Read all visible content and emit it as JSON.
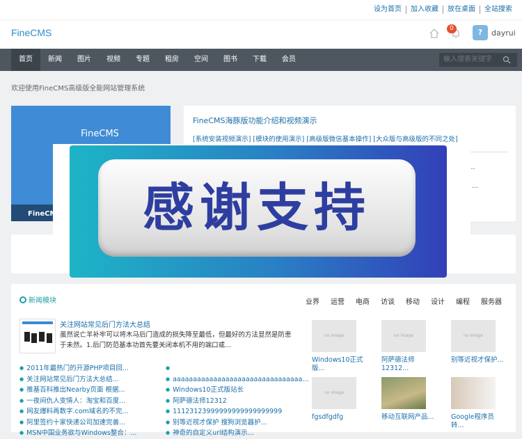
{
  "topbar": {
    "links": [
      "设为首页",
      "加入收藏",
      "放在桌面",
      "全站搜索"
    ]
  },
  "header": {
    "logo": "FineCMS",
    "notification_count": "0",
    "avatar_glyph": "?",
    "username": "dayrui"
  },
  "nav": {
    "items": [
      "首页",
      "新闻",
      "图片",
      "视频",
      "专题",
      "租房",
      "空间",
      "图书",
      "下载",
      "会员"
    ],
    "search_placeholder": "输入搜索关键字"
  },
  "welcome": "欢迎使用FineCMS高级版全能网站管理系统",
  "slide": {
    "title": "FineCMS",
    "caption": "FineCMS"
  },
  "panel": {
    "title": "FineCMS海豚版功能介绍和视频演示",
    "links": "[系统安装视频演示] [模块的使用演示] [高级版微信基本操作] [大众版与高级版的不同之处]",
    "tail1": "的不完...",
    "tail2": "..."
  },
  "overlay": {
    "text": "感谢支持"
  },
  "news": {
    "title": "新闻模块",
    "tabs": [
      "业界",
      "运营",
      "电商",
      "访谈",
      "移动",
      "设计",
      "编程",
      "服务器"
    ],
    "headline": {
      "title": "关注网站常见后门方法大总结",
      "desc": "虽然说亡羊补牢可以将木马后门造成的损失降至最低，但最好的方法显然是防患于未然。1.后门防范基本功首先要关闭本机不用的端口或..."
    },
    "list_left": [
      "2011年最热门的开源PHP项目回...",
      "关注网站常见后门方法大总结...",
      "推基百科推出Nearby页面 根据...",
      "一夜间仇人变情人：淘宝和百度...",
      "网友爆料再数字.com域名的不完...",
      "阿里签约十家快递公司加速完善...",
      "MSN中国业务欲与Windows整合：..."
    ],
    "list_right": [
      "",
      "aaaaaaaaaaaaaaaaaaaaaaaaaaaaaaaa...",
      "Windows10正式版站长",
      "阿萨德法师12312",
      "11123123999999999999999999",
      "别等近视才保护 搜狗浏览器护...",
      "神奇的自定义url结构演示..."
    ],
    "thumbs": [
      {
        "img": "no image",
        "caption": "Windows10正式版..."
      },
      {
        "img": "no image",
        "caption": "阿萨德法师12312..."
      },
      {
        "img": "no image",
        "caption": "别等近视才保护..."
      },
      {
        "img": "no image",
        "caption": "fgsdfgdfg"
      },
      {
        "img": "",
        "caption": "移动互联网产品..."
      },
      {
        "img": "",
        "caption": "Google程序员转..."
      }
    ]
  },
  "colors": {
    "nav_bg": "#4e5760",
    "link": "#1a6ea8",
    "accent": "#1aa0a8",
    "overlay_text": "#2e3ea0"
  }
}
